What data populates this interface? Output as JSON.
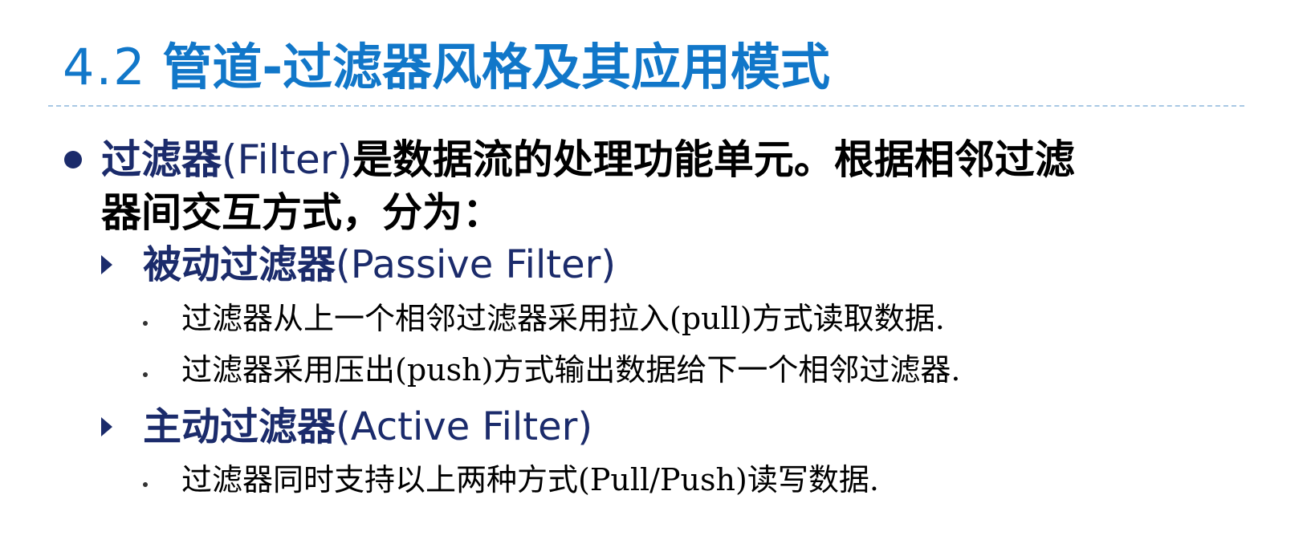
{
  "title": {
    "number": "4.2",
    "text": "管道-过滤器风格及其应用模式"
  },
  "point1": {
    "term": "过滤器",
    "term_en": "(Filter)",
    "rest_line1": "是数据流的处理功能单元。根据相邻过滤",
    "rest_line2": "器间交互方式，分为："
  },
  "passive": {
    "heading_cn": "被动过滤器",
    "heading_en": "(Passive Filter)",
    "items": [
      "过滤器从上一个相邻过滤器采用拉入(pull)方式读取数据.",
      "过滤器采用压出(push)方式输出数据给下一个相邻过滤器."
    ]
  },
  "active": {
    "heading_cn": "主动过滤器",
    "heading_en": "(Active Filter)",
    "items": [
      "过滤器同时支持以上两种方式(Pull/Push)读写数据."
    ]
  },
  "colors": {
    "title": "#1177c9",
    "heading": "#1b2b6b",
    "body": "#000000",
    "divider": "#a8c8e4"
  }
}
